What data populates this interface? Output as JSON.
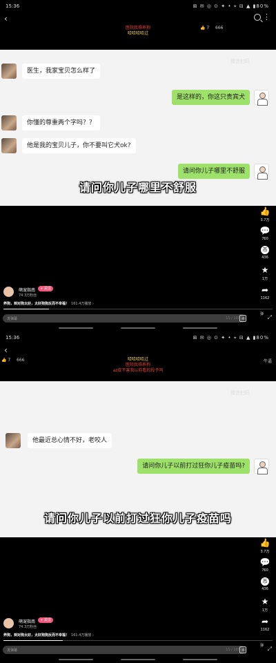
{
  "colors": {
    "accent_like": "#f2577a",
    "bubble_green": "#9de06a",
    "danmu_red": "#e8453c",
    "danmu_yellow": "#f2d64b"
  },
  "screens": [
    {
      "status": {
        "time": "15:36",
        "icons": "⊞ ✉ ◎ ⊙ ✦ • ⌖ ⊟ ▲ ▮80%"
      },
      "likes_top": "👍 7",
      "views_top": "666",
      "danmu": [
        {
          "text": "医院我得养狗",
          "color": "#e8453c"
        },
        {
          "text": "哈哈哈哈过",
          "color": "#f2d64b"
        }
      ],
      "watermark": "微信扫码",
      "chat": [
        {
          "side": "left",
          "text": "医生，我家宝贝怎么样了"
        },
        {
          "side": "right",
          "text": "是这样的，你这只贵宾犬"
        },
        {
          "side": "left",
          "text": "你懂的尊重两个字吗？？"
        },
        {
          "side": "left",
          "text": "他是我的宝贝儿子，你不要叫它犬ok?"
        },
        {
          "side": "right",
          "text": "请问你儿子哪里不舒服"
        }
      ],
      "subtitle": "请问你儿子哪里不舒服",
      "side": {
        "like": "3.7万",
        "comment": "760",
        "favorite": "436",
        "star": "1万",
        "share": "1162"
      },
      "author": {
        "name": "萌宠指南",
        "fans": "74.3万粉丝",
        "follow": "+ 关注"
      },
      "desc": {
        "bold": "养狗，到对狗太好，太好狗狗反而不幸福！",
        "plays": "161.4万播放 ›"
      },
      "progress": 0.17,
      "dm_placeholder": "发弹幕",
      "dm_count": "11 / 100",
      "dm_toggle": "弹",
      "fullscreen": "⤢"
    },
    {
      "status": {
        "time": "15:36",
        "icons": "⊞ ✉ ◎ ⊙ ✦ • ⌖ ⊟ ▲ ▮80%"
      },
      "likes_top": "👍 7",
      "views_top": "666",
      "right_top": "牛逼",
      "danmu": [
        {
          "text": "哈哈哈哈过",
          "color": "#f2d64b"
        },
        {
          "text": "医院我得养狗",
          "color": "#e8453c"
        },
        {
          "text": "az皮不害我以前看的段子吗",
          "color": "#e8453c"
        }
      ],
      "watermark": "微信扫码",
      "chat": [
        {
          "side": "left",
          "text": "他最近总心情不好，老咬人"
        },
        {
          "side": "right",
          "text": "请问你儿子以前打过狂你儿子疫苗吗?"
        }
      ],
      "subtitle": "请问你儿子以前打过狂你儿子疫苗吗",
      "side": {
        "like": "3.7万",
        "comment": "760",
        "favorite": "436",
        "star": "1万",
        "share": "1162"
      },
      "author": {
        "name": "萌宠指南",
        "fans": "74.3万粉丝",
        "follow": "+ 关注"
      },
      "desc": {
        "bold": "养狗，到对狗太好，太好狗狗反而不幸福！",
        "plays": "161.4万播放 ›"
      },
      "progress": 0.22,
      "dm_placeholder": "发弹幕",
      "dm_count": "11 / 100",
      "dm_toggle": "弹",
      "fullscreen": "⤢"
    }
  ]
}
